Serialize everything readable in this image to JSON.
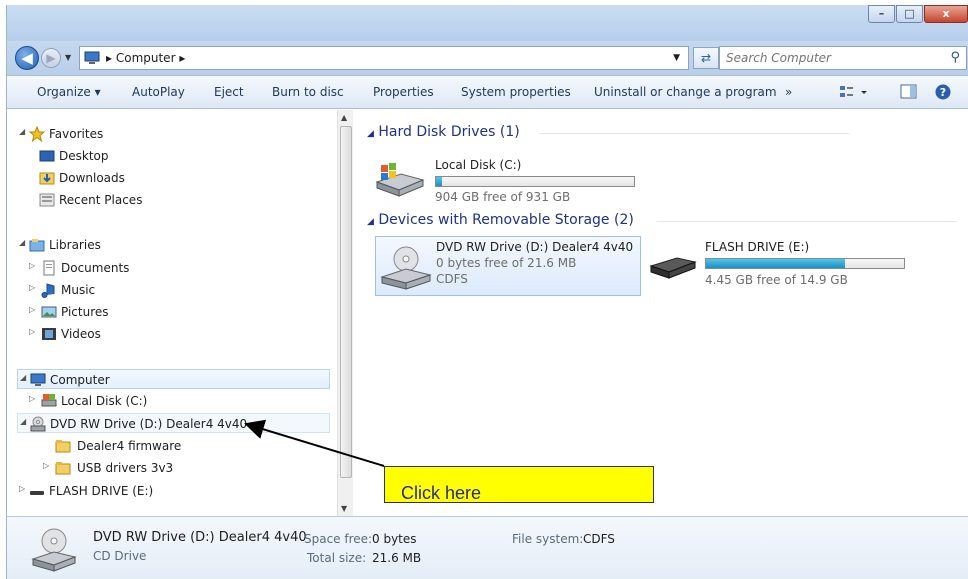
{
  "window": {
    "buttons": {
      "minimize": "–",
      "maximize": "□",
      "close": "x"
    }
  },
  "address": {
    "breadcrumb": "Computer",
    "search_placeholder": "Search Computer"
  },
  "toolbar": {
    "organize": "Organize ▾",
    "autoplay": "AutoPlay",
    "eject": "Eject",
    "burn": "Burn to disc",
    "properties": "Properties",
    "system_properties": "System properties",
    "uninstall": "Uninstall or change a program",
    "more": "»"
  },
  "nav": {
    "favorites": "Favorites",
    "desktop": "Desktop",
    "downloads": "Downloads",
    "recent": "Recent Places",
    "libraries": "Libraries",
    "documents": "Documents",
    "music": "Music",
    "pictures": "Pictures",
    "videos": "Videos",
    "computer": "Computer",
    "local_disk": "Local Disk (C:)",
    "dvd": "DVD RW Drive (D:) Dealer4 4v40",
    "firmware": "Dealer4 firmware",
    "usb_drivers": "USB drivers 3v3",
    "flash": "FLASH DRIVE (E:)"
  },
  "content": {
    "hdd_group": "Hard Disk Drives (1)",
    "removable_group": "Devices with Removable Storage (2)",
    "local_disk": {
      "name": "Local Disk (C:)",
      "free": "904 GB free of 931 GB",
      "used_fraction": 0.029
    },
    "dvd": {
      "name": "DVD RW Drive (D:) Dealer4 4v40",
      "free": "0 bytes free of 21.6 MB",
      "fs": "CDFS"
    },
    "flash": {
      "name": "FLASH DRIVE (E:)",
      "free": "4.45 GB free of 14.9 GB",
      "used_fraction": 0.7
    }
  },
  "details": {
    "name": "DVD RW Drive (D:) Dealer4 4v40",
    "type": "CD Drive",
    "space_free_label": "Space free:",
    "space_free": "0 bytes",
    "total_size_label": "Total size:",
    "total_size": "21.6 MB",
    "fs_label": "File system:",
    "fs": "CDFS"
  },
  "callout": {
    "text": "Click here"
  }
}
